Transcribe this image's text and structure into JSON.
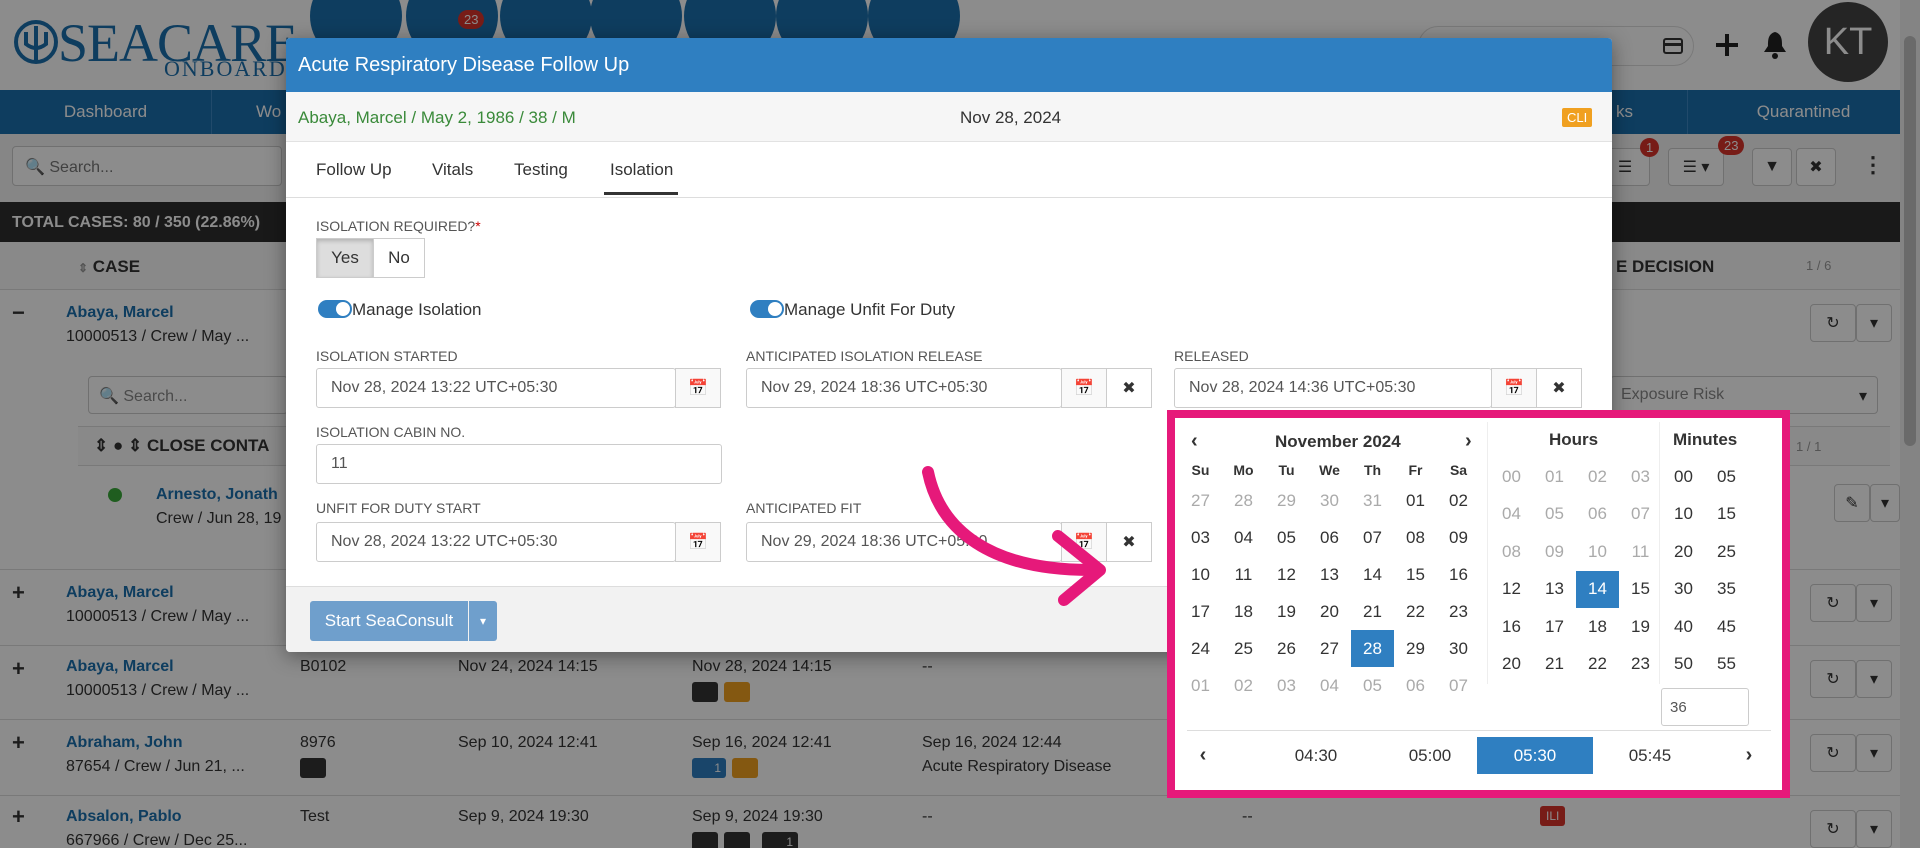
{
  "app": {
    "logo_main": "SEACARE",
    "logo_sub": "ONBOARD",
    "badges": {
      "messages": "23",
      "filter": "1",
      "list": "23"
    },
    "avatar_initials": "KT"
  },
  "nav": {
    "items": [
      "Dashboard",
      "Wo",
      "ks",
      "Quarantined"
    ]
  },
  "toolbar": {
    "search_placeholder": "Search..."
  },
  "totals": {
    "text": "TOTAL CASES: 80 / 350 (22.86%)"
  },
  "table": {
    "col_case": "CASE",
    "col_decision": "E DECISION",
    "pager": "1 / 6",
    "subsearch_placeholder": "Search...",
    "exposure_placeholder": "Exposure Risk",
    "contacts_header": "CLOSE CONTA",
    "contacts_pager": "1 / 1",
    "rows": [
      {
        "toggle": "−",
        "name": "Abaya, Marcel",
        "sub": "10000513 / Crew / May ..."
      },
      {
        "toggle": "+",
        "name": "Abaya, Marcel",
        "sub": "10000513 / Crew / May ..."
      },
      {
        "toggle": "+",
        "name": "Abaya, Marcel",
        "sub": "10000513 / Crew / May ...",
        "c2": "B0102",
        "c3": "Nov 24, 2024 14:15",
        "c4": "Nov 28, 2024 14:15",
        "c5": "--"
      },
      {
        "toggle": "+",
        "name": "Abraham, John",
        "sub": "87654 / Crew / Jun 21, ...",
        "c2": "8976",
        "c3": "Sep 10, 2024 12:41",
        "c4": "Sep 16, 2024 12:41",
        "c5": "Sep 16, 2024 12:44",
        "c5b": "Acute Respiratory Disease",
        "pin_count": "1"
      },
      {
        "toggle": "+",
        "name": "Absalon, Pablo",
        "sub": "667966 / Crew / Dec 25...",
        "c2": "Test",
        "c3": "Sep 9, 2024 19:30",
        "c4": "Sep 9, 2024 19:30",
        "c5": "--",
        "c6": "--",
        "tag": "ILI",
        "pin_count": "1"
      }
    ],
    "contact": {
      "name": "Arnesto, Jonath",
      "sub": "Crew / Jun 28, 19"
    }
  },
  "modal": {
    "title": "Acute Respiratory Disease Follow Up",
    "patient": "Abaya, Marcel / May 2, 1986 / 38 / M",
    "date": "Nov 28, 2024",
    "tag": "CLI",
    "tabs": [
      "Follow Up",
      "Vitals",
      "Testing",
      "Isolation"
    ],
    "isolation_required_label": "ISOLATION REQUIRED?",
    "required_mark": "*",
    "yes": "Yes",
    "no": "No",
    "manage_isolation": "Manage Isolation",
    "manage_unfit": "Manage Unfit For Duty",
    "isolation_started_label": "ISOLATION STARTED",
    "isolation_started_value": "Nov 28, 2024 13:22 UTC+05:30",
    "anticipated_release_label": "ANTICIPATED ISOLATION RELEASE",
    "anticipated_release_value": "Nov 29, 2024 18:36 UTC+05:30",
    "released_label": "RELEASED",
    "released_value": "Nov 28, 2024 14:36 UTC+05:30",
    "cabin_label": "ISOLATION CABIN NO.",
    "cabin_value": "11",
    "unfit_start_label": "UNFIT FOR DUTY START",
    "unfit_start_value": "Nov 28, 2024 13:22 UTC+05:30",
    "anticipated_fit_label": "ANTICIPATED FIT",
    "anticipated_fit_value": "Nov 29, 2024 18:36 UTC+05:30",
    "start_button": "Start SeaConsult"
  },
  "datepicker": {
    "month_title": "November 2024",
    "dow": [
      "Su",
      "Mo",
      "Tu",
      "We",
      "Th",
      "Fr",
      "Sa"
    ],
    "weeks": [
      [
        "27",
        "28",
        "29",
        "30",
        "31",
        "01",
        "02"
      ],
      [
        "03",
        "04",
        "05",
        "06",
        "07",
        "08",
        "09"
      ],
      [
        "10",
        "11",
        "12",
        "13",
        "14",
        "15",
        "16"
      ],
      [
        "17",
        "18",
        "19",
        "20",
        "21",
        "22",
        "23"
      ],
      [
        "24",
        "25",
        "26",
        "27",
        "28",
        "29",
        "30"
      ],
      [
        "01",
        "02",
        "03",
        "04",
        "05",
        "06",
        "07"
      ]
    ],
    "selected_day": "28",
    "hours_title": "Hours",
    "hours": [
      "00",
      "01",
      "02",
      "03",
      "04",
      "05",
      "06",
      "07",
      "08",
      "09",
      "10",
      "11",
      "12",
      "13",
      "14",
      "15",
      "16",
      "17",
      "18",
      "19",
      "20",
      "21",
      "22",
      "23"
    ],
    "selected_hour": "14",
    "minutes_title": "Minutes",
    "minutes": [
      "00",
      "05",
      "10",
      "15",
      "20",
      "25",
      "30",
      "35",
      "40",
      "45",
      "50",
      "55"
    ],
    "minute_input": "36",
    "timezones": [
      "04:30",
      "05:00",
      "05:30",
      "05:45"
    ],
    "selected_timezone": "05:30"
  },
  "colors": {
    "brand": "#1b6fae",
    "header": "#2f7fc1",
    "highlight": "#e6197a",
    "patient_green": "#3a8a3a",
    "cli_orange": "#f0a020"
  }
}
